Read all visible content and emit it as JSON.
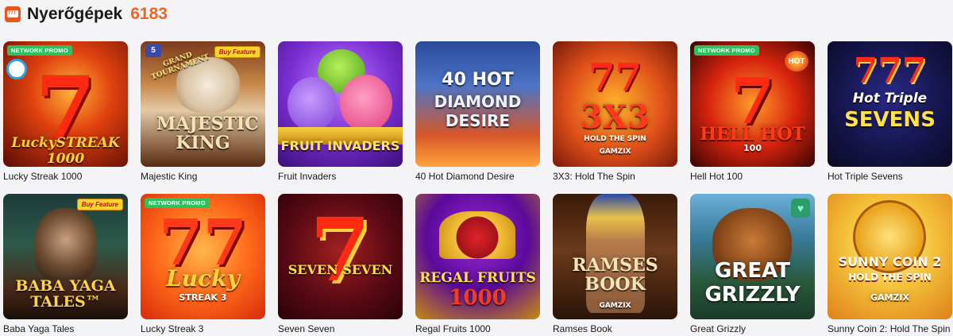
{
  "header": {
    "title": "Nyerőgépek",
    "count": "6183",
    "icon": "slot-machine-icon"
  },
  "badges": {
    "network_promo": "NETWORK PROMO",
    "buy_feature": "Buy Feature",
    "hot": "HOT"
  },
  "games": [
    {
      "name": "Lucky Streak 1000",
      "art": "LuckySTREAK 1000"
    },
    {
      "name": "Majestic King",
      "art": "MAJESTIC KING",
      "art_top": "GRAND TOURNAMENT"
    },
    {
      "name": "Fruit Invaders",
      "art": "FRUIT INVADERS"
    },
    {
      "name": "40 Hot Diamond Desire",
      "art_top": "40 HOT",
      "art": "DIAMOND DESIRE"
    },
    {
      "name": "3X3: Hold The Spin",
      "art": "3X3",
      "art_sub": "HOLD THE SPIN",
      "art_brand": "GAMZIX"
    },
    {
      "name": "Hell Hot 100",
      "art": "HELL HOT",
      "art_sub": "100"
    },
    {
      "name": "Hot Triple Sevens",
      "art_top": "Hot Triple",
      "art": "SEVENS"
    },
    {
      "name": "Baba Yaga Tales",
      "art": "BABA YAGA TALES™"
    },
    {
      "name": "Lucky Streak 3",
      "art": "Lucky",
      "art_sub": "STREAK 3"
    },
    {
      "name": "Seven Seven",
      "art": "SEVEN SEVEN"
    },
    {
      "name": "Regal Fruits 1000",
      "art": "REGAL FRUITS",
      "art_sub": "1000"
    },
    {
      "name": "Ramses Book",
      "art": "RAMSES BOOK",
      "art_brand": "GAMZIX"
    },
    {
      "name": "Great Grizzly",
      "art": "GREAT GRIZZLY"
    },
    {
      "name": "Sunny Coin 2: Hold The Spin",
      "art": "SUNNY COIN 2",
      "art_sub": "HOLD THE SPIN",
      "art_brand": "GAMZIX"
    }
  ]
}
